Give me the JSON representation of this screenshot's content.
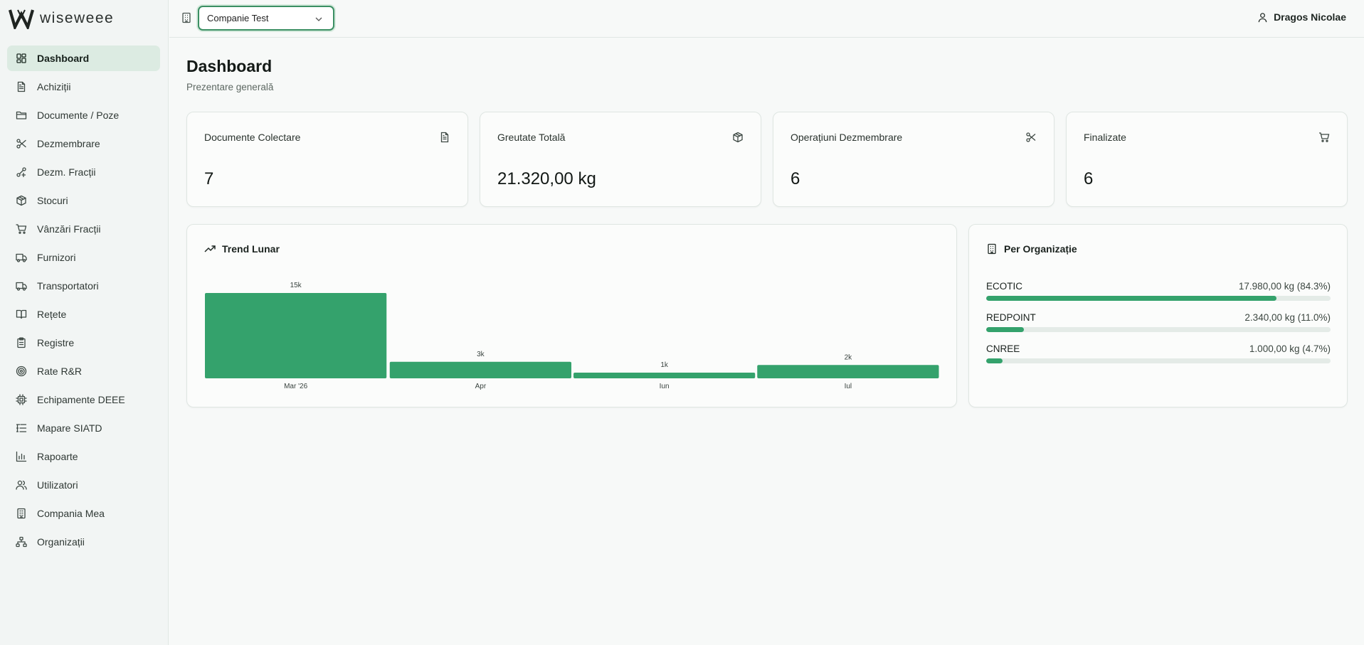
{
  "app": {
    "logo_text": "wiseweee"
  },
  "header": {
    "company_select": "Companie Test",
    "user_name": "Dragos Nicolae"
  },
  "sidebar": {
    "items": [
      {
        "label": "Dashboard",
        "icon": "dashboard-icon",
        "active": true
      },
      {
        "label": "Achiziții",
        "icon": "file-text-icon"
      },
      {
        "label": "Documente / Poze",
        "icon": "folder-icon"
      },
      {
        "label": "Dezmembrare",
        "icon": "scissors-icon"
      },
      {
        "label": "Dezm. Fracții",
        "icon": "split-icon"
      },
      {
        "label": "Stocuri",
        "icon": "package-icon"
      },
      {
        "label": "Vânzări Fracții",
        "icon": "cart-icon"
      },
      {
        "label": "Furnizori",
        "icon": "truck-icon"
      },
      {
        "label": "Transportatori",
        "icon": "truck-icon"
      },
      {
        "label": "Rețete",
        "icon": "book-icon"
      },
      {
        "label": "Registre",
        "icon": "clipboard-icon"
      },
      {
        "label": "Rate R&R",
        "icon": "target-icon"
      },
      {
        "label": "Echipamente DEEE",
        "icon": "chip-icon"
      },
      {
        "label": "Mapare SIATD",
        "icon": "list-tree-icon"
      },
      {
        "label": "Rapoarte",
        "icon": "bar-chart-icon"
      },
      {
        "label": "Utilizatori",
        "icon": "users-icon"
      },
      {
        "label": "Compania Mea",
        "icon": "building-icon"
      },
      {
        "label": "Organizații",
        "icon": "network-icon"
      }
    ]
  },
  "page": {
    "title": "Dashboard",
    "subtitle": "Prezentare generală"
  },
  "stats": [
    {
      "label": "Documente Colectare",
      "value": "7",
      "icon": "file-text-icon"
    },
    {
      "label": "Greutate Totală",
      "value": "21.320,00 kg",
      "icon": "package-icon"
    },
    {
      "label": "Operațiuni Dezmembrare",
      "value": "6",
      "icon": "scissors-icon"
    },
    {
      "label": "Finalizate",
      "value": "6",
      "icon": "cart-icon"
    }
  ],
  "trend": {
    "title": "Trend Lunar"
  },
  "organizations": {
    "title": "Per Organizație",
    "rows": [
      {
        "name": "ECOTIC",
        "value": "17.980,00 kg (84.3%)",
        "percent": 84.3
      },
      {
        "name": "REDPOINT",
        "value": "2.340,00 kg (11.0%)",
        "percent": 11.0
      },
      {
        "name": "CNREE",
        "value": "1.000,00 kg (4.7%)",
        "percent": 4.7
      }
    ]
  },
  "chart_data": {
    "type": "bar",
    "title": "Trend Lunar",
    "categories": [
      "Mar '26",
      "Apr",
      "Iun",
      "Iul"
    ],
    "values": [
      14980,
      2900,
      1000,
      2340
    ],
    "value_labels": [
      "15k",
      "3k",
      "1k",
      "2k"
    ],
    "color": "#34a26c",
    "grid": false,
    "ylim": [
      0,
      14980
    ]
  }
}
